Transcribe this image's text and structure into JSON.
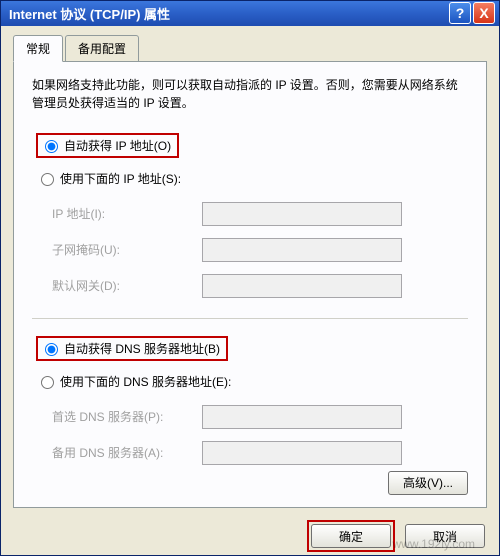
{
  "titlebar": {
    "title": "Internet 协议 (TCP/IP) 属性",
    "help_glyph": "?",
    "close_glyph": "X"
  },
  "tabs": {
    "general": "常规",
    "alternate": "备用配置"
  },
  "description": "如果网络支持此功能，则可以获取自动指派的 IP 设置。否则，您需要从网络系统管理员处获得适当的 IP 设置。",
  "ip": {
    "auto_label": "自动获得 IP 地址(O)",
    "manual_label": "使用下面的 IP 地址(S):",
    "ip_address_label": "IP 地址(I):",
    "subnet_label": "子网掩码(U):",
    "gateway_label": "默认网关(D):"
  },
  "dns": {
    "auto_label": "自动获得 DNS 服务器地址(B)",
    "manual_label": "使用下面的 DNS 服务器地址(E):",
    "preferred_label": "首选 DNS 服务器(P):",
    "alternate_label": "备用 DNS 服务器(A):"
  },
  "buttons": {
    "advanced": "高级(V)...",
    "ok": "确定",
    "cancel": "取消"
  },
  "watermark": "www.192ly.com"
}
